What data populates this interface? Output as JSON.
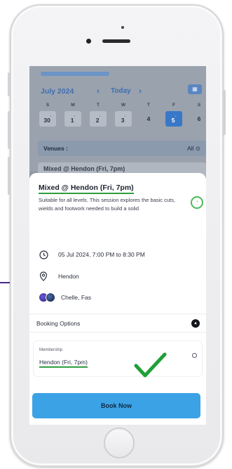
{
  "calendar": {
    "month": "July 2024",
    "prev_icon": "chevron-left-icon",
    "next_icon": "chevron-right-icon",
    "today_label": "Today",
    "weekdays": [
      "S",
      "M",
      "T",
      "W",
      "T",
      "F",
      "S"
    ],
    "dates": [
      {
        "day": "30",
        "mark": "·"
      },
      {
        "day": "1",
        "mark": "·"
      },
      {
        "day": "2",
        "mark": "·"
      },
      {
        "day": "3",
        "mark": "·"
      },
      {
        "day": "4",
        "mark": ""
      },
      {
        "day": "5",
        "mark": "·"
      },
      {
        "day": "6",
        "mark": ""
      }
    ],
    "selected_date": "5",
    "view_calendar_icon": "calendar-grid-icon",
    "view_list_icon": "list-icon"
  },
  "venues": {
    "label": "Venues :",
    "value": "All",
    "chevron_icon": "circle-chevron-icon"
  },
  "peek_card": {
    "title": "Mixed @ Hendon (Fri, 7pm)"
  },
  "session": {
    "title": "Mixed @ Hendon (Fri, 7pm)",
    "description": "Suitable for all levels. This session explores the basic cuts, wields and footwork needed to build a solid",
    "status_icon": "clock-status-icon",
    "time": "05 Jul 2024, 7:00 PM to 8:30 PM",
    "venue": "Hendon",
    "coaches": "Chelle, Fas"
  },
  "booking": {
    "label": "Booking Options",
    "toggle_icon": "collapse-icon",
    "membership_label": "Membership",
    "membership_name": "Hendon (Fri, 7pm)",
    "book_button": "Book Now"
  },
  "annotation": {
    "check_color": "#1fa038",
    "underline_color": "#2f9e3f"
  },
  "colors": {
    "accent": "#3ca2e6",
    "selected_date": "#3978c8"
  }
}
